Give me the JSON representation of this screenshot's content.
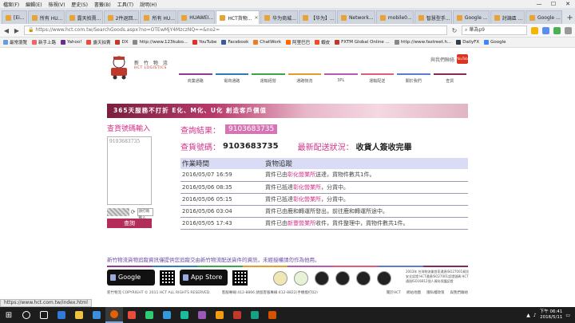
{
  "browser": {
    "menu": [
      "檔案(F)",
      "編輯(E)",
      "檢視(V)",
      "歷史(S)",
      "書籤(B)",
      "工具(T)",
      "說明(H)"
    ],
    "tabs": [
      {
        "label": "[Ei..."
      },
      {
        "label": "所有 HU..."
      },
      {
        "label": "露天拍賣..."
      },
      {
        "label": "2件退回..."
      },
      {
        "label": "所有 HU..."
      },
      {
        "label": "HUAWEI..."
      },
      {
        "label": "HCT貨物...",
        "active": true
      },
      {
        "label": "华为商城..."
      },
      {
        "label": "【华为】..."
      },
      {
        "label": "Network..."
      },
      {
        "label": "mobile0..."
      },
      {
        "label": "智慧型手..."
      },
      {
        "label": "Google ..."
      },
      {
        "label": "討論區 ..."
      },
      {
        "label": "Google ..."
      }
    ],
    "url": "https://www.hct.com.tw/SearchGoods.aspx?no=OTEwMjY4MzczNQ==&no2=",
    "search_value": "華為p9",
    "bookmarks": [
      {
        "label": "最常瀏覽"
      },
      {
        "label": "新手上路"
      },
      {
        "label": "Yahoo!"
      },
      {
        "label": "露天拍賣"
      },
      {
        "label": "DX"
      },
      {
        "label": "http://www.123kubo..."
      },
      {
        "label": "YouTube"
      },
      {
        "label": "Facebook"
      },
      {
        "label": "ChatWork"
      },
      {
        "label": "阿里巴巴"
      },
      {
        "label": "蝦皮"
      },
      {
        "label": "FXTM Global Online ..."
      },
      {
        "label": "http://www.fastreet.h..."
      },
      {
        "label": "DailyFX"
      },
      {
        "label": "Google"
      }
    ],
    "status_url": "https://www.hct.com.tw/index.html"
  },
  "site": {
    "logo_text": "新 竹 物 流",
    "logo_sub": "HCT LOGISTICS",
    "header_link": "與我們聯絡",
    "youtube_label": "YouTube",
    "nav": [
      {
        "label": "商業通路",
        "color": "#8e3a8f"
      },
      {
        "label": "電商通路",
        "color": "#2b7bb9"
      },
      {
        "label": "運輸經營",
        "color": "#3aa64b"
      },
      {
        "label": "通路物流",
        "color": "#e39b2b"
      },
      {
        "label": "3PL",
        "color": "#b55ab0"
      },
      {
        "label": "運輸配送",
        "color": "#e35b7a"
      },
      {
        "label": "關於我們",
        "color": "#5a7bd5"
      },
      {
        "label": "查貨",
        "color": "#8a2a5a"
      }
    ],
    "banner": "365天服務不打折 E化、M化、U化 創造客戶價值"
  },
  "query": {
    "label": "查貨號碼輸入",
    "textarea_value": "9103683735",
    "captcha_placeholder": "請打碼輸入",
    "button": "查詢"
  },
  "result": {
    "label": "查詢結果：",
    "value": "9103683735",
    "tracking_label": "查貨號碼：",
    "tracking_value": "9103683735",
    "status_label": "最新配送狀況：",
    "status_value": "收貨人簽收完畢",
    "table_headers": [
      "作業時間",
      "貨物追蹤"
    ],
    "rows": [
      {
        "time": "2016/05/07 16:59",
        "pre": "貨件已由",
        "place": "彰化營業所",
        "post": "送達，貨物件數共1件。"
      },
      {
        "time": "2016/05/06 08:35",
        "pre": "貨件已抵達",
        "place": "彰化營業所",
        "post": "，分貨中。"
      },
      {
        "time": "2016/05/06 05:15",
        "pre": "貨件已抵達",
        "place": "彰化營業所",
        "post": "，分貨中。"
      },
      {
        "time": "2016/05/06 03:04",
        "pre": "貨件已由鹿和轉運所發出，前往鹿和轉運所途中。",
        "place": "",
        "post": ""
      },
      {
        "time": "2016/05/05 17:43",
        "pre": "貨件已由",
        "place": "新豐營業所",
        "post": "收件，貨件整理中，貨物件數共1件。"
      }
    ]
  },
  "footer": {
    "note": "新竹物流貨物追蹤資訊僅提供您追蹤交由新竹物流配送貨件的資訊，未經授權請勿作為他用。",
    "rule_colors": [
      "#8e3a8f",
      "#2b7bb9",
      "#3aa64b",
      "#e39b2b",
      "#b55ab0",
      "#e35b7a",
      "#5a7bd5",
      "#8a2a5a"
    ],
    "google_play": "Google play",
    "app_store": "App Store",
    "cert_text": "2003年 台灣物流業首家通過ISO27001資訊安全認證 HCT通過ISO27001認證號碼 HCT通過ISO16812個人資料保護認證",
    "copyright": "新竹物流 COPYRIGHT © 2011 HCT ALL RIGHTS RESERVED.",
    "phone": "客服專線:412-8866 請留客服專線:412-8822(手機撥打02)",
    "links": [
      "關於HCT",
      "網站地圖",
      "隱私權政策",
      "與我們聯絡"
    ]
  },
  "taskbar": {
    "time": "下午 06:41",
    "date": "2016/5/11"
  }
}
